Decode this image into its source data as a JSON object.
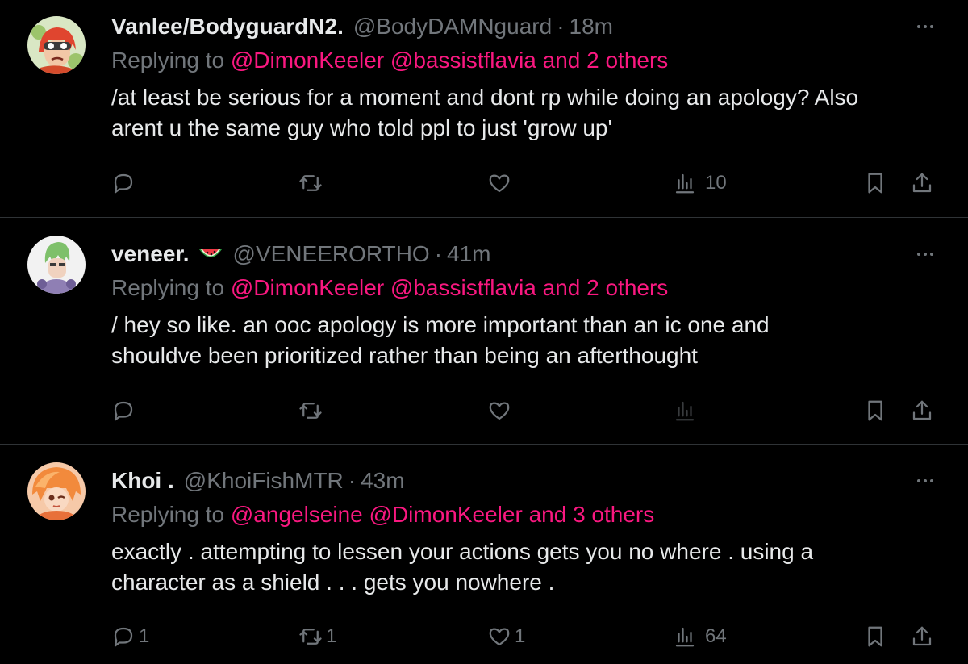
{
  "tweets": [
    {
      "name": "Vanlee/BodyguardN2.",
      "handle": "@BodyDAMNguard",
      "time": "18m",
      "replying_to_label": "Replying to",
      "mentions": "@DimonKeeler @bassistflavia and 2 others",
      "body_lines": [
        "/at least be serious for a moment and dont rp while doing an apology? Also",
        "arent u the same guy who told ppl to just 'grow up'"
      ],
      "replies": "",
      "reposts": "",
      "likes": "",
      "views": "10",
      "avatar_icon": "red-hair-avatar"
    },
    {
      "name": "veneer.",
      "emoji": "watermelon-icon",
      "handle": "@VENEERORTHO",
      "time": "41m",
      "replying_to_label": "Replying to",
      "mentions": "@DimonKeeler @bassistflavia and 2 others",
      "body_lines": [
        "/ hey so like. an ooc apology is more important than an ic one and",
        "shouldve been prioritized rather than being an afterthought"
      ],
      "replies": "",
      "reposts": "",
      "likes": "",
      "views": "",
      "avatar_icon": "green-hair-avatar"
    },
    {
      "name": "Khoi .",
      "handle": "@KhoiFishMTR",
      "time": "43m",
      "replying_to_label": "Replying to",
      "mentions": "@angelseine @DimonKeeler and 3 others",
      "body_lines": [
        "exactly . attempting to lessen your actions gets you no where . using a",
        "character as a shield . . . gets you nowhere ."
      ],
      "replies": "1",
      "reposts": "1",
      "likes": "1",
      "views": "64",
      "avatar_icon": "orange-hair-avatar"
    }
  ],
  "colors": {
    "background": "#000000",
    "text": "#e7e9ea",
    "muted": "#71767b",
    "mention": "#f91880",
    "divider": "#2f3336"
  }
}
